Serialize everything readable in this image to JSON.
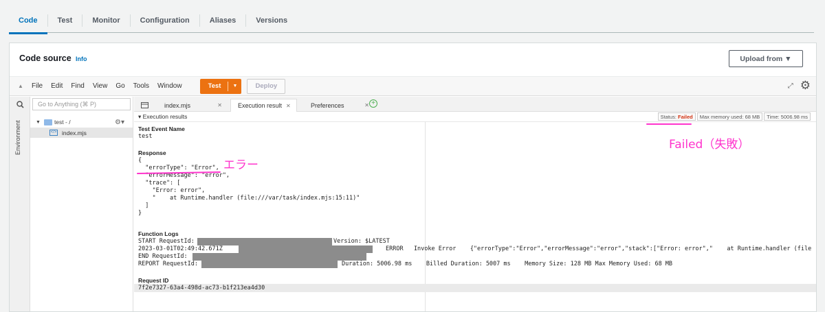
{
  "tabs": [
    {
      "label": "Code",
      "active": true
    },
    {
      "label": "Test"
    },
    {
      "label": "Monitor"
    },
    {
      "label": "Configuration"
    },
    {
      "label": "Aliases"
    },
    {
      "label": "Versions"
    }
  ],
  "header": {
    "title": "Code source",
    "info": "Info",
    "upload": "Upload from ▼"
  },
  "menubar": {
    "items": [
      "File",
      "Edit",
      "Find",
      "View",
      "Go",
      "Tools",
      "Window"
    ],
    "test_label": "Test",
    "deploy_label": "Deploy"
  },
  "sidebar": {
    "environment_label": "Environment",
    "goto_placeholder": "Go to Anything (⌘ P)",
    "folder": "test - /",
    "file": "index.mjs"
  },
  "editor_tabs": [
    {
      "label": "index.mjs"
    },
    {
      "label": "Execution result",
      "active": true
    },
    {
      "label": "Preferences"
    }
  ],
  "results": {
    "header": "▾ Execution results",
    "status_label": "Status:",
    "status_value": "Failed",
    "max_memory": "Max memory used: 68 MB",
    "time": "Time: 5006.98 ms",
    "test_event_label": "Test Event Name",
    "test_event_value": "test",
    "response_label": "Response",
    "response_lines": [
      "{",
      "  \"errorType\": \"Error\",",
      "  \"errorMessage\": \"error\",",
      "  \"trace\": [",
      "    \"Error: error\",",
      "    \"    at Runtime.handler (file:///var/task/index.mjs:15:11)\"",
      "  ]",
      "}"
    ],
    "logs_label": "Function Logs",
    "log_start": "START RequestId:",
    "log_start_version": "Version: $LATEST",
    "log_time": "2023-03-01T02:49:42.671Z",
    "log_error": "ERROR   Invoke Error    {\"errorType\":\"Error\",\"errorMessage\":\"error\",\"stack\":[\"Error: error\",\"    at Runtime.handler (file",
    "log_end": "END RequestId:",
    "log_report": "REPORT RequestId:",
    "log_report_rest": "Duration: 5006.98 ms    Billed Duration: 5007 ms    Memory Size: 128 MB Max Memory Used: 68 MB",
    "request_id_label": "Request ID",
    "request_id_value": "7f2e7327-63a4-498d-ac73-b1f213ea4d30"
  },
  "annotations": {
    "error_note": "エラー",
    "failed_note": "Failed（失敗）"
  },
  "colors": {
    "accent": "#0073bb",
    "orange": "#ec7211",
    "failed": "#d13212",
    "annotation": "#ff33cc"
  }
}
